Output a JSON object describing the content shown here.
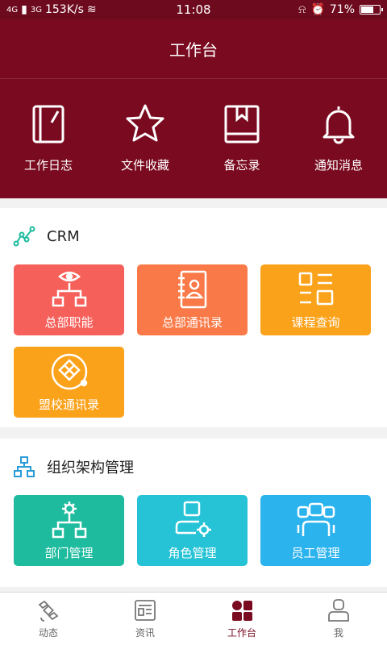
{
  "status_bar": {
    "network_left": "4G",
    "network_right": "3G",
    "speed": "153K/s",
    "time": "11:08",
    "battery_text": "71%",
    "battery_level": 0.71
  },
  "header": {
    "title": "工作台",
    "quick_actions": [
      {
        "label": "工作日志",
        "icon": "notebook-icon"
      },
      {
        "label": "文件收藏",
        "icon": "star-icon"
      },
      {
        "label": "备忘录",
        "icon": "bookmark-book-icon"
      },
      {
        "label": "通知消息",
        "icon": "bell-icon"
      }
    ]
  },
  "crm": {
    "title": "CRM",
    "tiles": [
      {
        "label": "总部职能",
        "color": "#f6605a"
      },
      {
        "label": "总部通讯录",
        "color": "#f97a48"
      },
      {
        "label": "课程查询",
        "color": "#fba21b"
      },
      {
        "label": "盟校通讯录",
        "color": "#fba21b"
      }
    ]
  },
  "org": {
    "title": "组织架构管理",
    "tiles": [
      {
        "label": "部门管理",
        "color": "#1ebb9e"
      },
      {
        "label": "角色管理",
        "color": "#25c3d5"
      },
      {
        "label": "员工管理",
        "color": "#2bb3ee"
      }
    ]
  },
  "tabbar": {
    "items": [
      {
        "label": "动态",
        "active": false
      },
      {
        "label": "资讯",
        "active": false
      },
      {
        "label": "工作台",
        "active": true
      },
      {
        "label": "我",
        "active": false
      }
    ]
  },
  "colors": {
    "brand": "#7a0a1f",
    "crm_icon": "#1ebb9e",
    "org_icon": "#2b9bd8"
  }
}
